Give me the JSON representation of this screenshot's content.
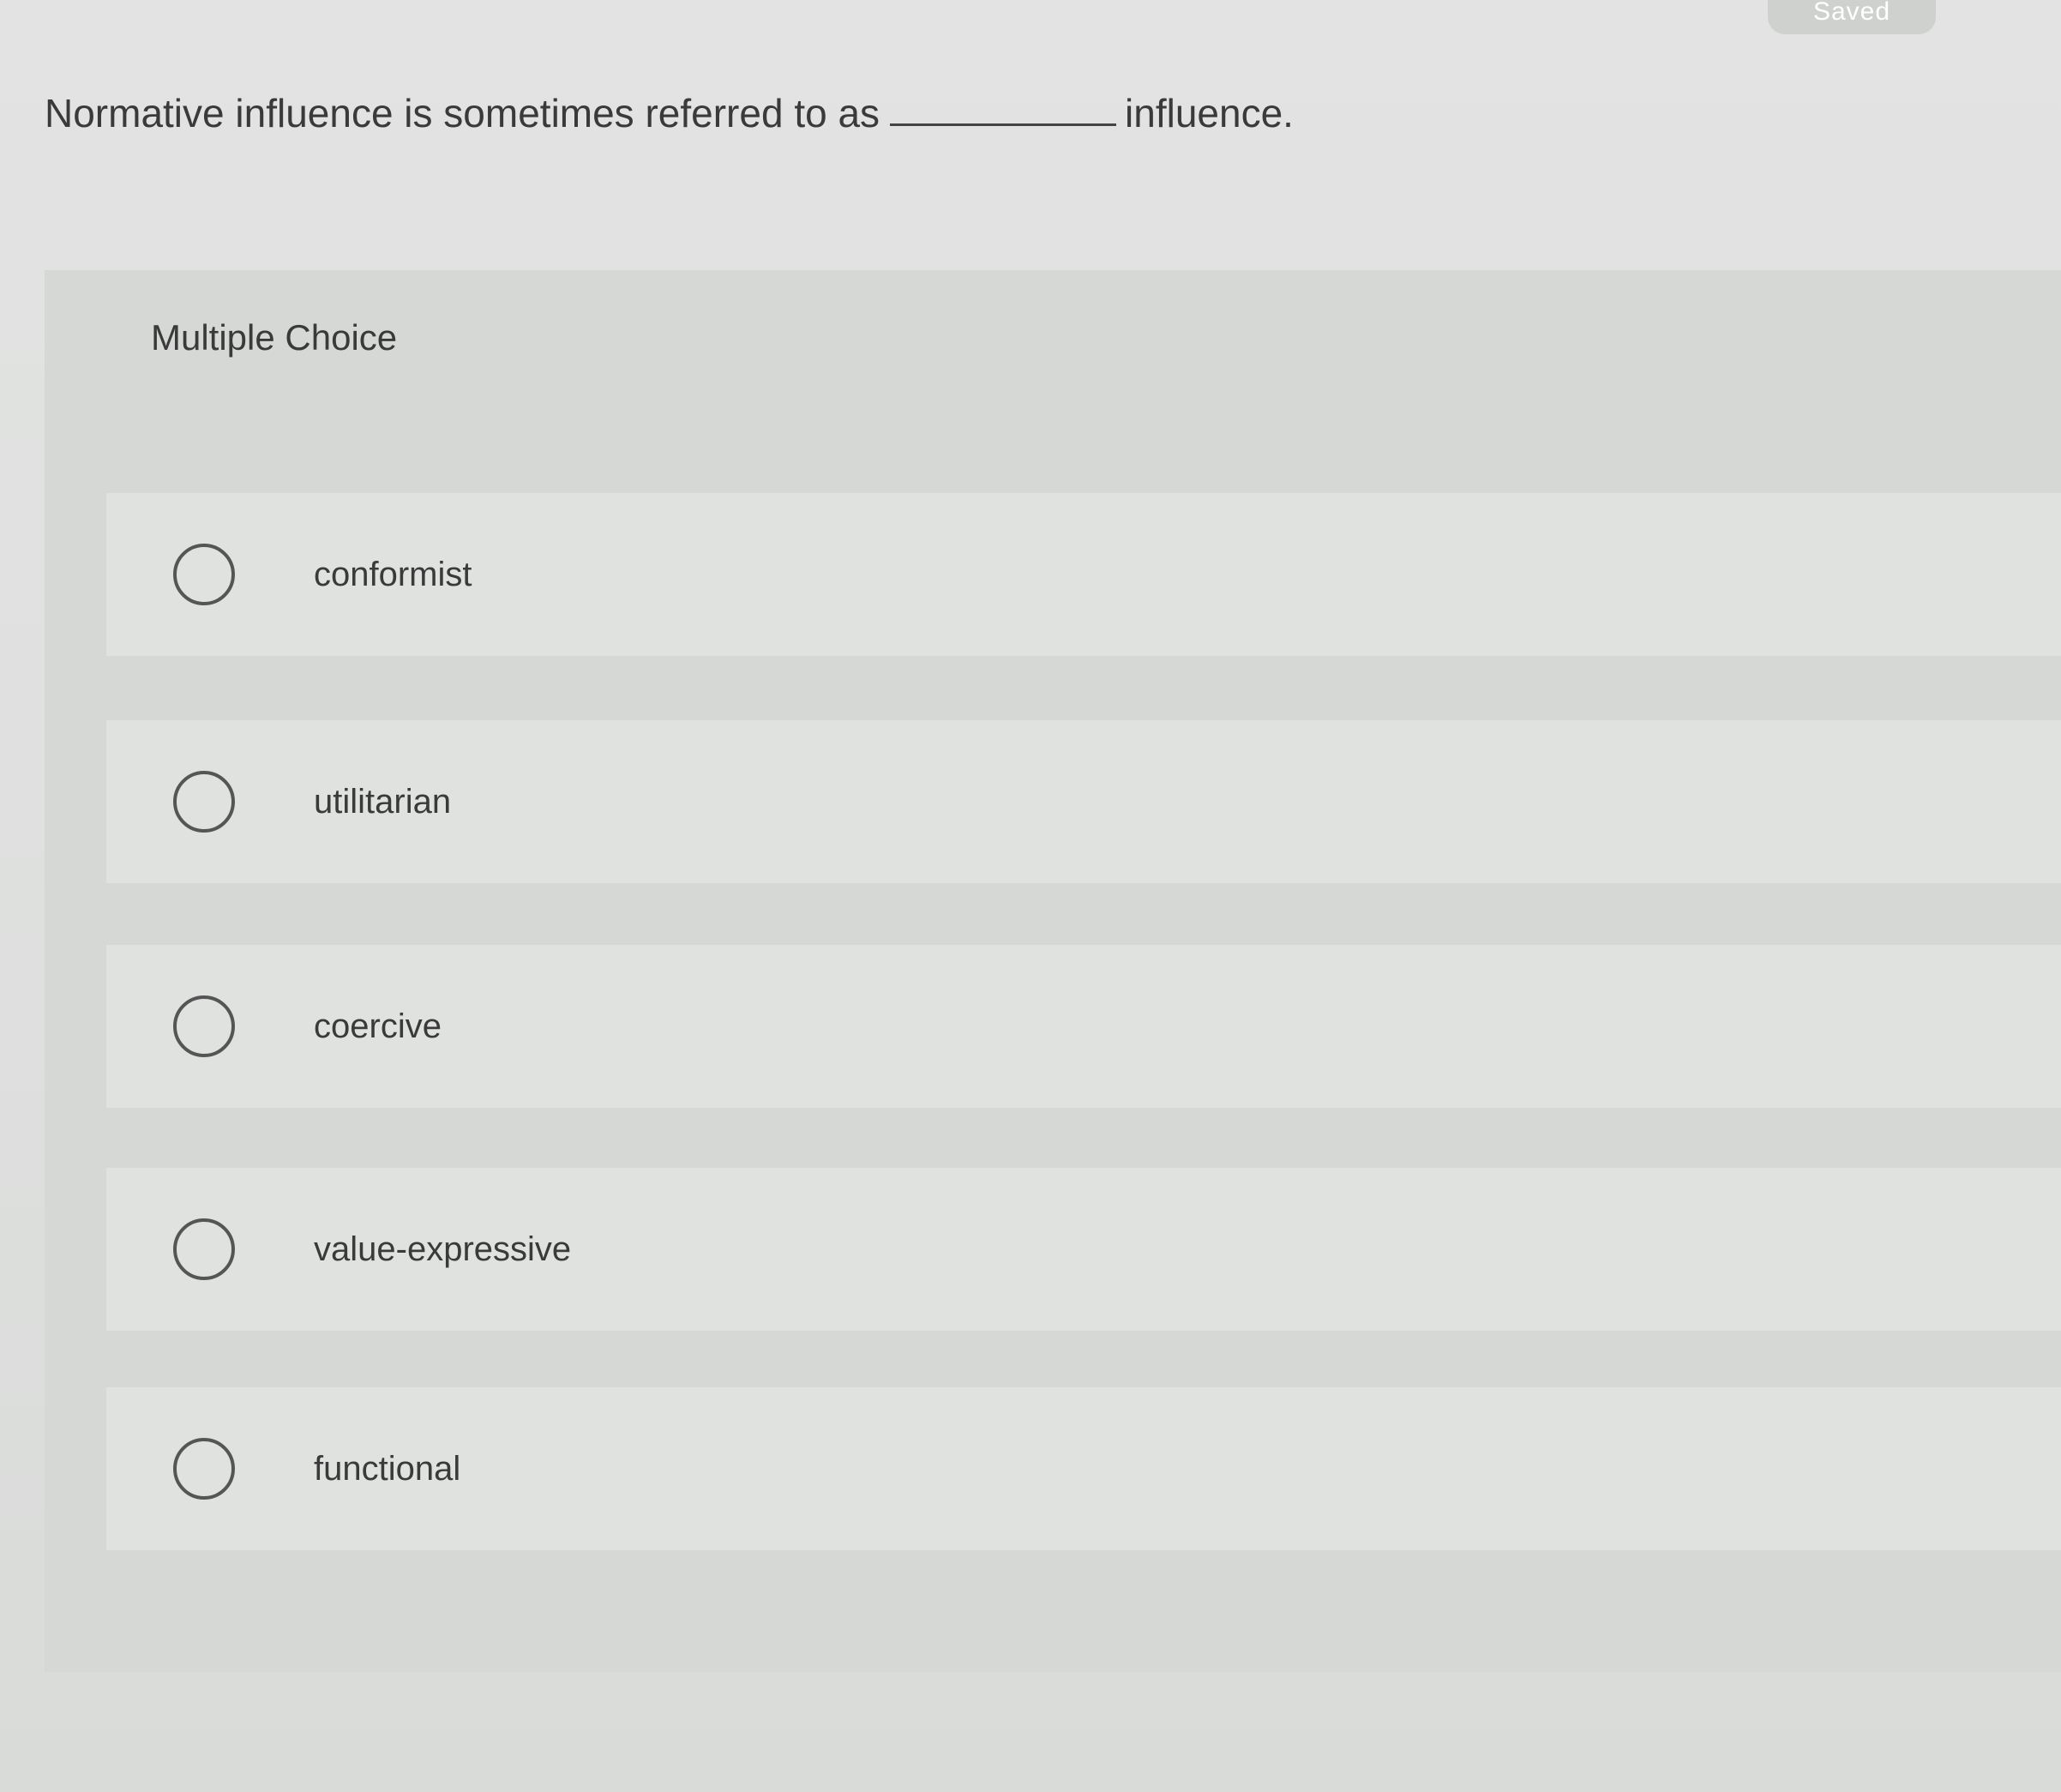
{
  "status": {
    "saved_label": "Saved"
  },
  "question": {
    "text_before": "Normative influence is sometimes referred to as",
    "text_after": "influence."
  },
  "answer_card": {
    "label": "Multiple Choice",
    "options": [
      {
        "label": "conformist",
        "selected": false
      },
      {
        "label": "utilitarian",
        "selected": false
      },
      {
        "label": "coercive",
        "selected": false
      },
      {
        "label": "value-expressive",
        "selected": false
      },
      {
        "label": "functional",
        "selected": false
      }
    ]
  }
}
